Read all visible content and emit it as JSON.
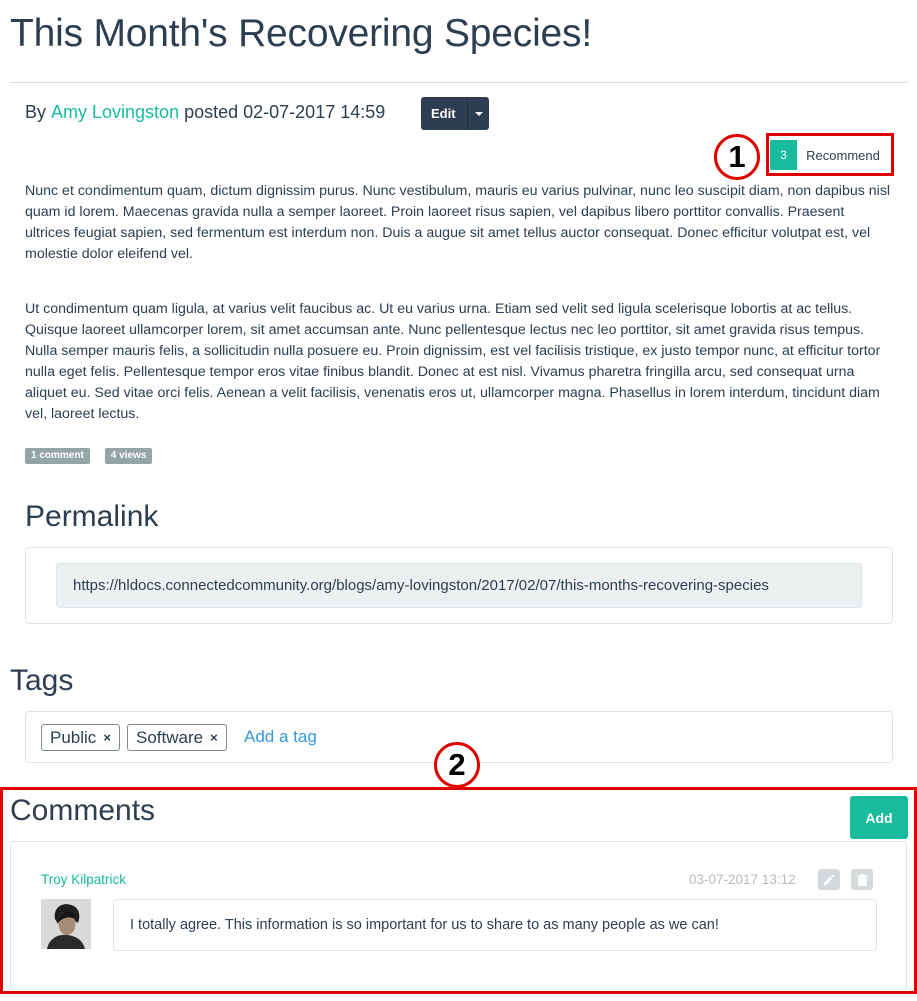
{
  "post": {
    "title": "This Month's Recovering Species!",
    "by_label": "By",
    "author": "Amy Lovingston",
    "posted_label": "posted 02-07-2017 14:59",
    "edit_label": "Edit",
    "recommend_count": "3",
    "recommend_label": "Recommend",
    "paragraphs": [
      "Nunc et condimentum quam, dictum dignissim purus. Nunc vestibulum, mauris eu varius pulvinar, nunc leo suscipit diam, non dapibus nisl quam id lorem. Maecenas gravida nulla a semper laoreet. Proin laoreet risus sapien, vel dapibus libero porttitor convallis. Praesent ultrices feugiat sapien, sed fermentum est interdum non. Duis a augue sit amet tellus auctor consequat. Donec efficitur volutpat est, vel molestie dolor eleifend vel.",
      "Ut condimentum quam ligula, at varius velit faucibus ac. Ut eu varius urna. Etiam sed velit sed ligula scelerisque lobortis at ac tellus. Quisque laoreet ullamcorper lorem, sit amet accumsan ante. Nunc pellentesque lectus nec leo porttitor, sit amet gravida risus tempus. Nulla semper mauris felis, a sollicitudin nulla posuere eu. Proin dignissim, est vel facilisis tristique, ex justo tempor nunc, at efficitur tortor nulla eget felis. Pellentesque tempor eros vitae finibus blandit. Donec at est nisl. Vivamus pharetra fringilla arcu, sed consequat urna aliquet eu. Sed vitae orci felis. Aenean a velit facilisis, venenatis eros ut, ullamcorper magna. Phasellus in lorem interdum, tincidunt diam vel, laoreet lectus."
    ],
    "badges": [
      "1 comment",
      "4 views"
    ]
  },
  "permalink": {
    "heading": "Permalink",
    "url": "https://hldocs.connectedcommunity.org/blogs/amy-lovingston/2017/02/07/this-months-recovering-species"
  },
  "tags": {
    "heading": "Tags",
    "items": [
      "Public",
      "Software"
    ],
    "remove_glyph": "×",
    "add_label": "Add a tag"
  },
  "comments": {
    "heading": "Comments",
    "add_label": "Add",
    "items": [
      {
        "author": "Troy Kilpatrick",
        "date": "03-07-2017 13:12",
        "text": "I totally agree. This information is so important for us to share to as many people as we can!"
      }
    ]
  },
  "annotations": {
    "callout_1": "1",
    "callout_2": "2",
    "color": "#e00000"
  },
  "icons": [
    "caret-down-icon",
    "pencil-icon",
    "trash-icon",
    "close-icon"
  ],
  "colors": {
    "accent": "#18bc9c",
    "primary": "#2c3e50",
    "link": "#3498db",
    "badge": "#95a5a6"
  }
}
